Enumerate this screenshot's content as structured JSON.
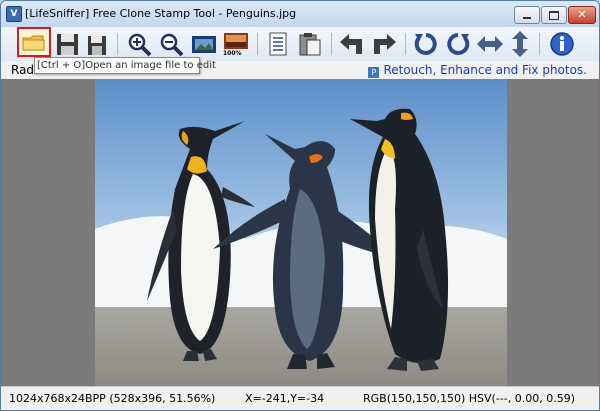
{
  "window": {
    "app_icon": "lifesniffer-app-icon",
    "title": "[LifeSniffer]  Free Clone Stamp Tool - Penguins.jpg",
    "close_label": "✕"
  },
  "toolbar": {
    "items": [
      {
        "name": "open-file-button",
        "icon": "folder-icon"
      },
      {
        "name": "save-button",
        "icon": "floppy-disk-icon"
      },
      {
        "name": "save-as-button",
        "icon": "floppy-disk-small-icon"
      },
      {
        "name": "zoom-in-button",
        "icon": "zoom-in-icon"
      },
      {
        "name": "zoom-out-button",
        "icon": "zoom-out-icon"
      },
      {
        "name": "fit-window-button",
        "icon": "fit-to-window-icon"
      },
      {
        "name": "actual-size-button",
        "icon": "actual-size-icon",
        "label": "100%"
      },
      {
        "name": "copy-button",
        "icon": "document-icon"
      },
      {
        "name": "paste-button",
        "icon": "clipboard-icon"
      },
      {
        "name": "undo-button",
        "icon": "undo-arrow-icon"
      },
      {
        "name": "redo-button",
        "icon": "redo-arrow-icon"
      },
      {
        "name": "rotate-left-button",
        "icon": "rotate-left-icon"
      },
      {
        "name": "rotate-right-button",
        "icon": "rotate-right-icon"
      },
      {
        "name": "flip-horizontal-button",
        "icon": "flip-horizontal-icon"
      },
      {
        "name": "flip-vertical-button",
        "icon": "flip-vertical-icon"
      },
      {
        "name": "info-button",
        "icon": "info-icon"
      }
    ],
    "actual_size_label": "100%"
  },
  "subbar": {
    "radius_label": "Rad",
    "retouch_link": "Retouch, Enhance and Fix photos."
  },
  "tooltip": {
    "text": "[Ctrl + O]Open an image file to edit"
  },
  "status": {
    "image_info": "1024x768x24BPP (528x396, 51.56%)",
    "cursor_pos": "X=-241,Y=-34",
    "color_info": "RGB(150,150,150) HSV(---, 0.00, 0.59)"
  },
  "colors": {
    "accent": "#1a3fb0",
    "highlight_border": "#d21e1e",
    "canvas_bg": "#7b7b7b"
  }
}
